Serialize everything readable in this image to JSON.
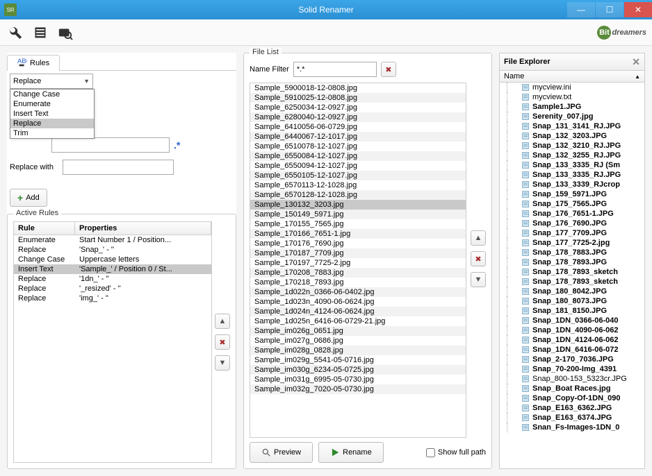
{
  "window": {
    "title": "Solid Renamer"
  },
  "brand": {
    "prefix": "Bit",
    "suffix": "dreamers"
  },
  "rules_tab": {
    "label": "Rules"
  },
  "combo": {
    "selected": "Replace",
    "options": [
      "Change Case",
      "Enumerate",
      "Insert Text",
      "Replace",
      "Trim"
    ]
  },
  "form": {
    "replace_with_label": "Replace with",
    "add_label": "Add"
  },
  "active_rules": {
    "legend": "Active Rules",
    "headers": {
      "rule": "Rule",
      "props": "Properties"
    },
    "rows": [
      {
        "rule": "Enumerate",
        "props": "Start Number 1 / Position..."
      },
      {
        "rule": "Replace",
        "props": "'Snap_' - ''"
      },
      {
        "rule": "Change Case",
        "props": "Uppercase letters"
      },
      {
        "rule": "Insert Text",
        "props": "'Sample_' / Position 0 / St...",
        "selected": true
      },
      {
        "rule": "Replace",
        "props": "'1dn_' - ''"
      },
      {
        "rule": "Replace",
        "props": "'_resized' - ''"
      },
      {
        "rule": "Replace",
        "props": "'img_' - ''"
      }
    ]
  },
  "filelist": {
    "legend": "File List",
    "filter_label": "Name Filter",
    "filter_value": "*.*",
    "preview_label": "Preview",
    "rename_label": "Rename",
    "showfull_label": "Show full path",
    "items": [
      "Sample_5900018-12-0808.jpg",
      "Sample_5910025-12-0808.jpg",
      "Sample_6250034-12-0927.jpg",
      "Sample_6280040-12-0927.jpg",
      "Sample_6410056-06-0729.jpg",
      "Sample_6440067-12-1017.jpg",
      "Sample_6510078-12-1027.jpg",
      "Sample_6550084-12-1027.jpg",
      "Sample_6550094-12-1027.jpg",
      "Sample_6550105-12-1027.jpg",
      "Sample_6570113-12-1028.jpg",
      "Sample_6570128-12-1028.jpg",
      "Sample_130132_3203.jpg",
      "Sample_150149_5971.jpg",
      "Sample_170155_7565.jpg",
      "Sample_170166_7651-1.jpg",
      "Sample_170176_7690.jpg",
      "Sample_170187_7709.jpg",
      "Sample_170197_7725-2.jpg",
      "Sample_170208_7883.jpg",
      "Sample_170218_7893.jpg",
      "Sample_1d022n_0366-06-0402.jpg",
      "Sample_1d023n_4090-06-0624.jpg",
      "Sample_1d024n_4124-06-0624.jpg",
      "Sample_1d025n_6416-06-0729-21.jpg",
      "Sample_im026g_0651.jpg",
      "Sample_im027g_0686.jpg",
      "Sample_im028g_0828.jpg",
      "Sample_im029g_5541-05-0716.jpg",
      "Sample_im030g_6234-05-0725.jpg",
      "Sample_im031g_6995-05-0730.jpg",
      "Sample_im032g_7020-05-0730.jpg"
    ],
    "selected_index": 12
  },
  "explorer": {
    "title": "File Explorer",
    "col_name": "Name",
    "items": [
      {
        "name": "mycview.ini",
        "bold": false
      },
      {
        "name": "mycview.txt",
        "bold": false
      },
      {
        "name": "Sample1.JPG",
        "bold": true
      },
      {
        "name": "Serenity_007.jpg",
        "bold": true
      },
      {
        "name": "Snap_131_3141_RJ.JPG",
        "bold": true
      },
      {
        "name": "Snap_132_3203.JPG",
        "bold": true
      },
      {
        "name": "Snap_132_3210_RJ.JPG",
        "bold": true
      },
      {
        "name": "Snap_132_3255_RJ.JPG",
        "bold": true
      },
      {
        "name": "Snap_133_3335_RJ (Sm",
        "bold": true
      },
      {
        "name": "Snap_133_3335_RJ.JPG",
        "bold": true
      },
      {
        "name": "Snap_133_3339_RJcrop",
        "bold": true
      },
      {
        "name": "Snap_159_5971.JPG",
        "bold": true
      },
      {
        "name": "Snap_175_7565.JPG",
        "bold": true
      },
      {
        "name": "Snap_176_7651-1.JPG",
        "bold": true
      },
      {
        "name": "Snap_176_7690.JPG",
        "bold": true
      },
      {
        "name": "Snap_177_7709.JPG",
        "bold": true
      },
      {
        "name": "Snap_177_7725-2.jpg",
        "bold": true
      },
      {
        "name": "Snap_178_7883.JPG",
        "bold": true
      },
      {
        "name": "Snap_178_7893.JPG",
        "bold": true
      },
      {
        "name": "Snap_178_7893_sketch",
        "bold": true
      },
      {
        "name": "Snap_178_7893_sketch",
        "bold": true
      },
      {
        "name": "Snap_180_8042.JPG",
        "bold": true
      },
      {
        "name": "Snap_180_8073.JPG",
        "bold": true
      },
      {
        "name": "Snap_181_8150.JPG",
        "bold": true
      },
      {
        "name": "Snap_1DN_0366-06-040",
        "bold": true
      },
      {
        "name": "Snap_1DN_4090-06-062",
        "bold": true
      },
      {
        "name": "Snap_1DN_4124-06-062",
        "bold": true
      },
      {
        "name": "Snap_1DN_6416-06-072",
        "bold": true
      },
      {
        "name": "Snap_2-170_7036.JPG",
        "bold": true
      },
      {
        "name": "Snap_70-200-Img_4391",
        "bold": true
      },
      {
        "name": "Snap_800-153_5323cr.JPG",
        "bold": false
      },
      {
        "name": "Snap_Boat Races.jpg",
        "bold": true
      },
      {
        "name": "Snap_Copy-Of-1DN_090",
        "bold": true
      },
      {
        "name": "Snap_E163_6362.JPG",
        "bold": true
      },
      {
        "name": "Snap_E163_6374.JPG",
        "bold": true
      },
      {
        "name": "Snan_Fs-Images-1DN_0",
        "bold": true
      }
    ]
  }
}
